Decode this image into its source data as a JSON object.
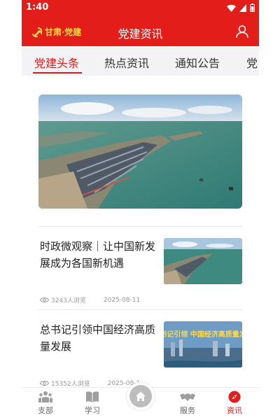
{
  "status_bar": {
    "time": "1:40"
  },
  "app_bar": {
    "logo_text": "甘肃·党建",
    "title": "党建资讯"
  },
  "tabs": [
    "党建头条",
    "热点资讯",
    "通知公告",
    "党"
  ],
  "articles": [
    {
      "title": "时政微观察｜让中国新发展成为各国新机遇",
      "views": "3243人浏览",
      "date": "2025-08-11"
    },
    {
      "title": "总书记引领中国经济高质量发展",
      "views": "15352人浏览",
      "date": "2025-08-1"
    }
  ],
  "article2_banner_text": "总书记引领 中国经济高质量发展",
  "bottom_nav": [
    {
      "label": "支部",
      "icon": "people-icon"
    },
    {
      "label": "学习",
      "icon": "book-icon"
    },
    {
      "label": "",
      "icon": "home-icon"
    },
    {
      "label": "服务",
      "icon": "handshake-icon"
    },
    {
      "label": "资讯",
      "icon": "compass-icon"
    }
  ],
  "colors": {
    "brand_red": "#e31d1a",
    "logo_gold": "#ffd84a",
    "tab_bg": "#f3f3f5",
    "meta_gray": "#9a9a9a"
  }
}
